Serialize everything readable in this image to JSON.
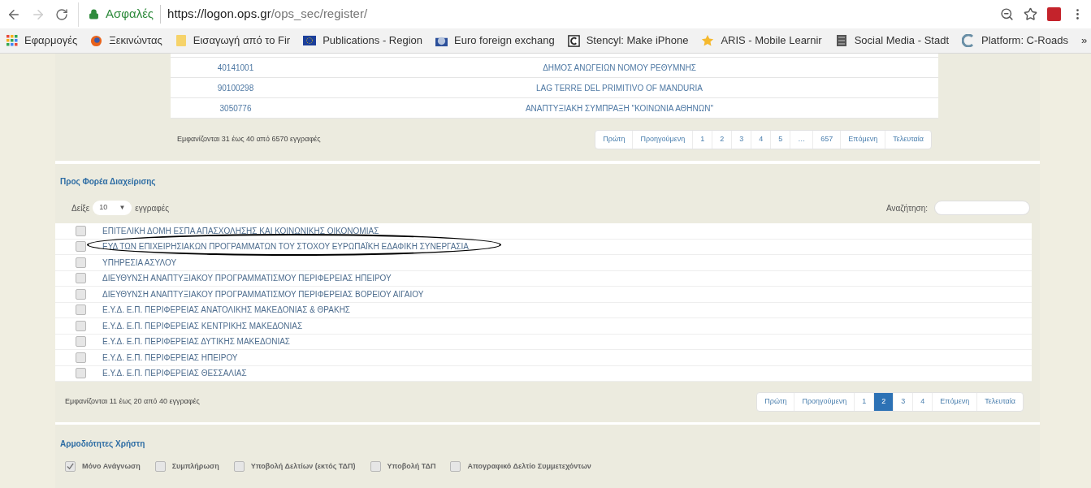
{
  "browser": {
    "secure_label": "Ασφαλές",
    "url_host": "https://logon.ops.gr",
    "url_path": "/ops_sec/register/",
    "bookmarks": [
      "Εφαρμογές",
      "Ξεκινώντας",
      "Εισαγωγή από το Fir",
      "Publications - Region",
      "Euro foreign exchang",
      "Stencyl: Make iPhone",
      "ARIS - Mobile Learnir",
      "Social Media - Stadt",
      "Platform: C-Roads"
    ],
    "more": "»"
  },
  "upper_table": {
    "rows": [
      {
        "code": "40141001",
        "name": "ΔΗΜΟΣ ΑΝΩΓΕΙΩΝ ΝΟΜΟΥ ΡΕΘΥΜΝΗΣ"
      },
      {
        "code": "90100298",
        "name": "LAG TERRE DEL PRIMITIVO OF MANDURIA"
      },
      {
        "code": "3050776",
        "name": "ΑΝΑΠΤΥΞΙΑΚΗ ΣΥΜΠΡΑΞΗ \"ΚΟΙΝΩΝΙΑ ΑΘΗΝΩΝ\""
      }
    ],
    "info": "Εμφανίζονται 31 έως 40 από 6570 εγγραφές",
    "pages": [
      {
        "label": "Πρώτη",
        "selected": false
      },
      {
        "label": "Προηγούμενη",
        "selected": false
      },
      {
        "label": "1",
        "selected": false
      },
      {
        "label": "2",
        "selected": false
      },
      {
        "label": "3",
        "selected": false
      },
      {
        "label": "4",
        "selected": false
      },
      {
        "label": "5",
        "selected": false
      },
      {
        "label": "…",
        "selected": false
      },
      {
        "label": "657",
        "selected": false
      },
      {
        "label": "Επόμενη",
        "selected": false
      },
      {
        "label": "Τελευταία",
        "selected": false
      }
    ]
  },
  "managing_authority": {
    "title": "Προς Φορέα Διαχείρισης",
    "show_label": "Δείξε",
    "page_size": "10",
    "dropdown_arrow": "▼",
    "records_label": "εγγραφές",
    "search_label": "Αναζήτηση:",
    "rows": [
      {
        "name": "ΕΠΙΤΕΛΙΚΗ ΔΟΜΗ ΕΣΠΑ ΑΠΑΣΧΟΛΗΣΗΣ ΚΑΙ ΚΟΙΝΩΝΙΚΗΣ ΟΙΚΟΝΟΜΙΑΣ",
        "checked": false,
        "circled": false
      },
      {
        "name": "ΕΥΔ ΤΩΝ ΕΠΙΧΕΙΡΗΣΙΑΚΩΝ ΠΡΟΓΡΑΜΜΑΤΩΝ ΤΟΥ ΣΤΟΧΟΥ ΕΥΡΩΠΑΪΚΗ ΕΔΑΦΙΚΗ ΣΥΝΕΡΓΑΣΙΑ",
        "checked": false,
        "circled": true
      },
      {
        "name": "ΥΠΗΡΕΣΙΑ ΑΣΥΛΟΥ",
        "checked": false,
        "circled": false
      },
      {
        "name": "ΔΙΕΥΘΥΝΣΗ ΑΝΑΠΤΥΞΙΑΚΟΥ ΠΡΟΓΡΑΜΜΑΤΙΣΜΟΥ ΠΕΡΙΦΕΡΕΙΑΣ ΗΠΕΙΡΟΥ",
        "checked": false,
        "circled": false
      },
      {
        "name": "ΔΙΕΥΘΥΝΣΗ ΑΝΑΠΤΥΞΙΑΚΟΥ ΠΡΟΓΡΑΜΜΑΤΙΣΜΟΥ ΠΕΡΙΦΕΡΕΙΑΣ ΒΟΡΕΙΟΥ ΑΙΓΑΙΟΥ",
        "checked": false,
        "circled": false
      },
      {
        "name": "Ε.Υ.Δ. Ε.Π. ΠΕΡΙΦΕΡΕΙΑΣ ΑΝΑΤΟΛΙΚΗΣ ΜΑΚΕΔΟΝΙΑΣ & ΘΡΑΚΗΣ",
        "checked": false,
        "circled": false
      },
      {
        "name": "Ε.Υ.Δ. Ε.Π. ΠΕΡΙΦΕΡΕΙΑΣ ΚΕΝΤΡΙΚΗΣ ΜΑΚΕΔΟΝΙΑΣ",
        "checked": false,
        "circled": false
      },
      {
        "name": "Ε.Υ.Δ. Ε.Π. ΠΕΡΙΦΕΡΕΙΑΣ ΔΥΤΙΚΗΣ ΜΑΚΕΔΟΝΙΑΣ",
        "checked": false,
        "circled": false
      },
      {
        "name": "Ε.Υ.Δ. Ε.Π. ΠΕΡΙΦΕΡΕΙΑΣ ΗΠΕΙΡΟΥ",
        "checked": false,
        "circled": false
      },
      {
        "name": "Ε.Υ.Δ. Ε.Π. ΠΕΡΙΦΕΡΕΙΑΣ ΘΕΣΣΑΛΙΑΣ",
        "checked": false,
        "circled": false
      }
    ],
    "info": "Εμφανίζονται 11 έως 20 από 40 εγγραφές",
    "pages": [
      {
        "label": "Πρώτη",
        "selected": false
      },
      {
        "label": "Προηγούμενη",
        "selected": false
      },
      {
        "label": "1",
        "selected": false
      },
      {
        "label": "2",
        "selected": true
      },
      {
        "label": "3",
        "selected": false
      },
      {
        "label": "4",
        "selected": false
      },
      {
        "label": "Επόμενη",
        "selected": false
      },
      {
        "label": "Τελευταία",
        "selected": false
      }
    ]
  },
  "user_permissions": {
    "title": "Αρμοδιότητες Χρήστη",
    "options": [
      {
        "label": "Μόνο Ανάγνωση",
        "checked": true
      },
      {
        "label": "Συμπλήρωση",
        "checked": false
      },
      {
        "label": "Υποβολή Δελτίων (εκτός ΤΔΠ)",
        "checked": false
      },
      {
        "label": "Υποβολή ΤΔΠ",
        "checked": false
      },
      {
        "label": "Απογραφικό Δελτίο Συμμετεχόντων",
        "checked": false
      }
    ]
  }
}
